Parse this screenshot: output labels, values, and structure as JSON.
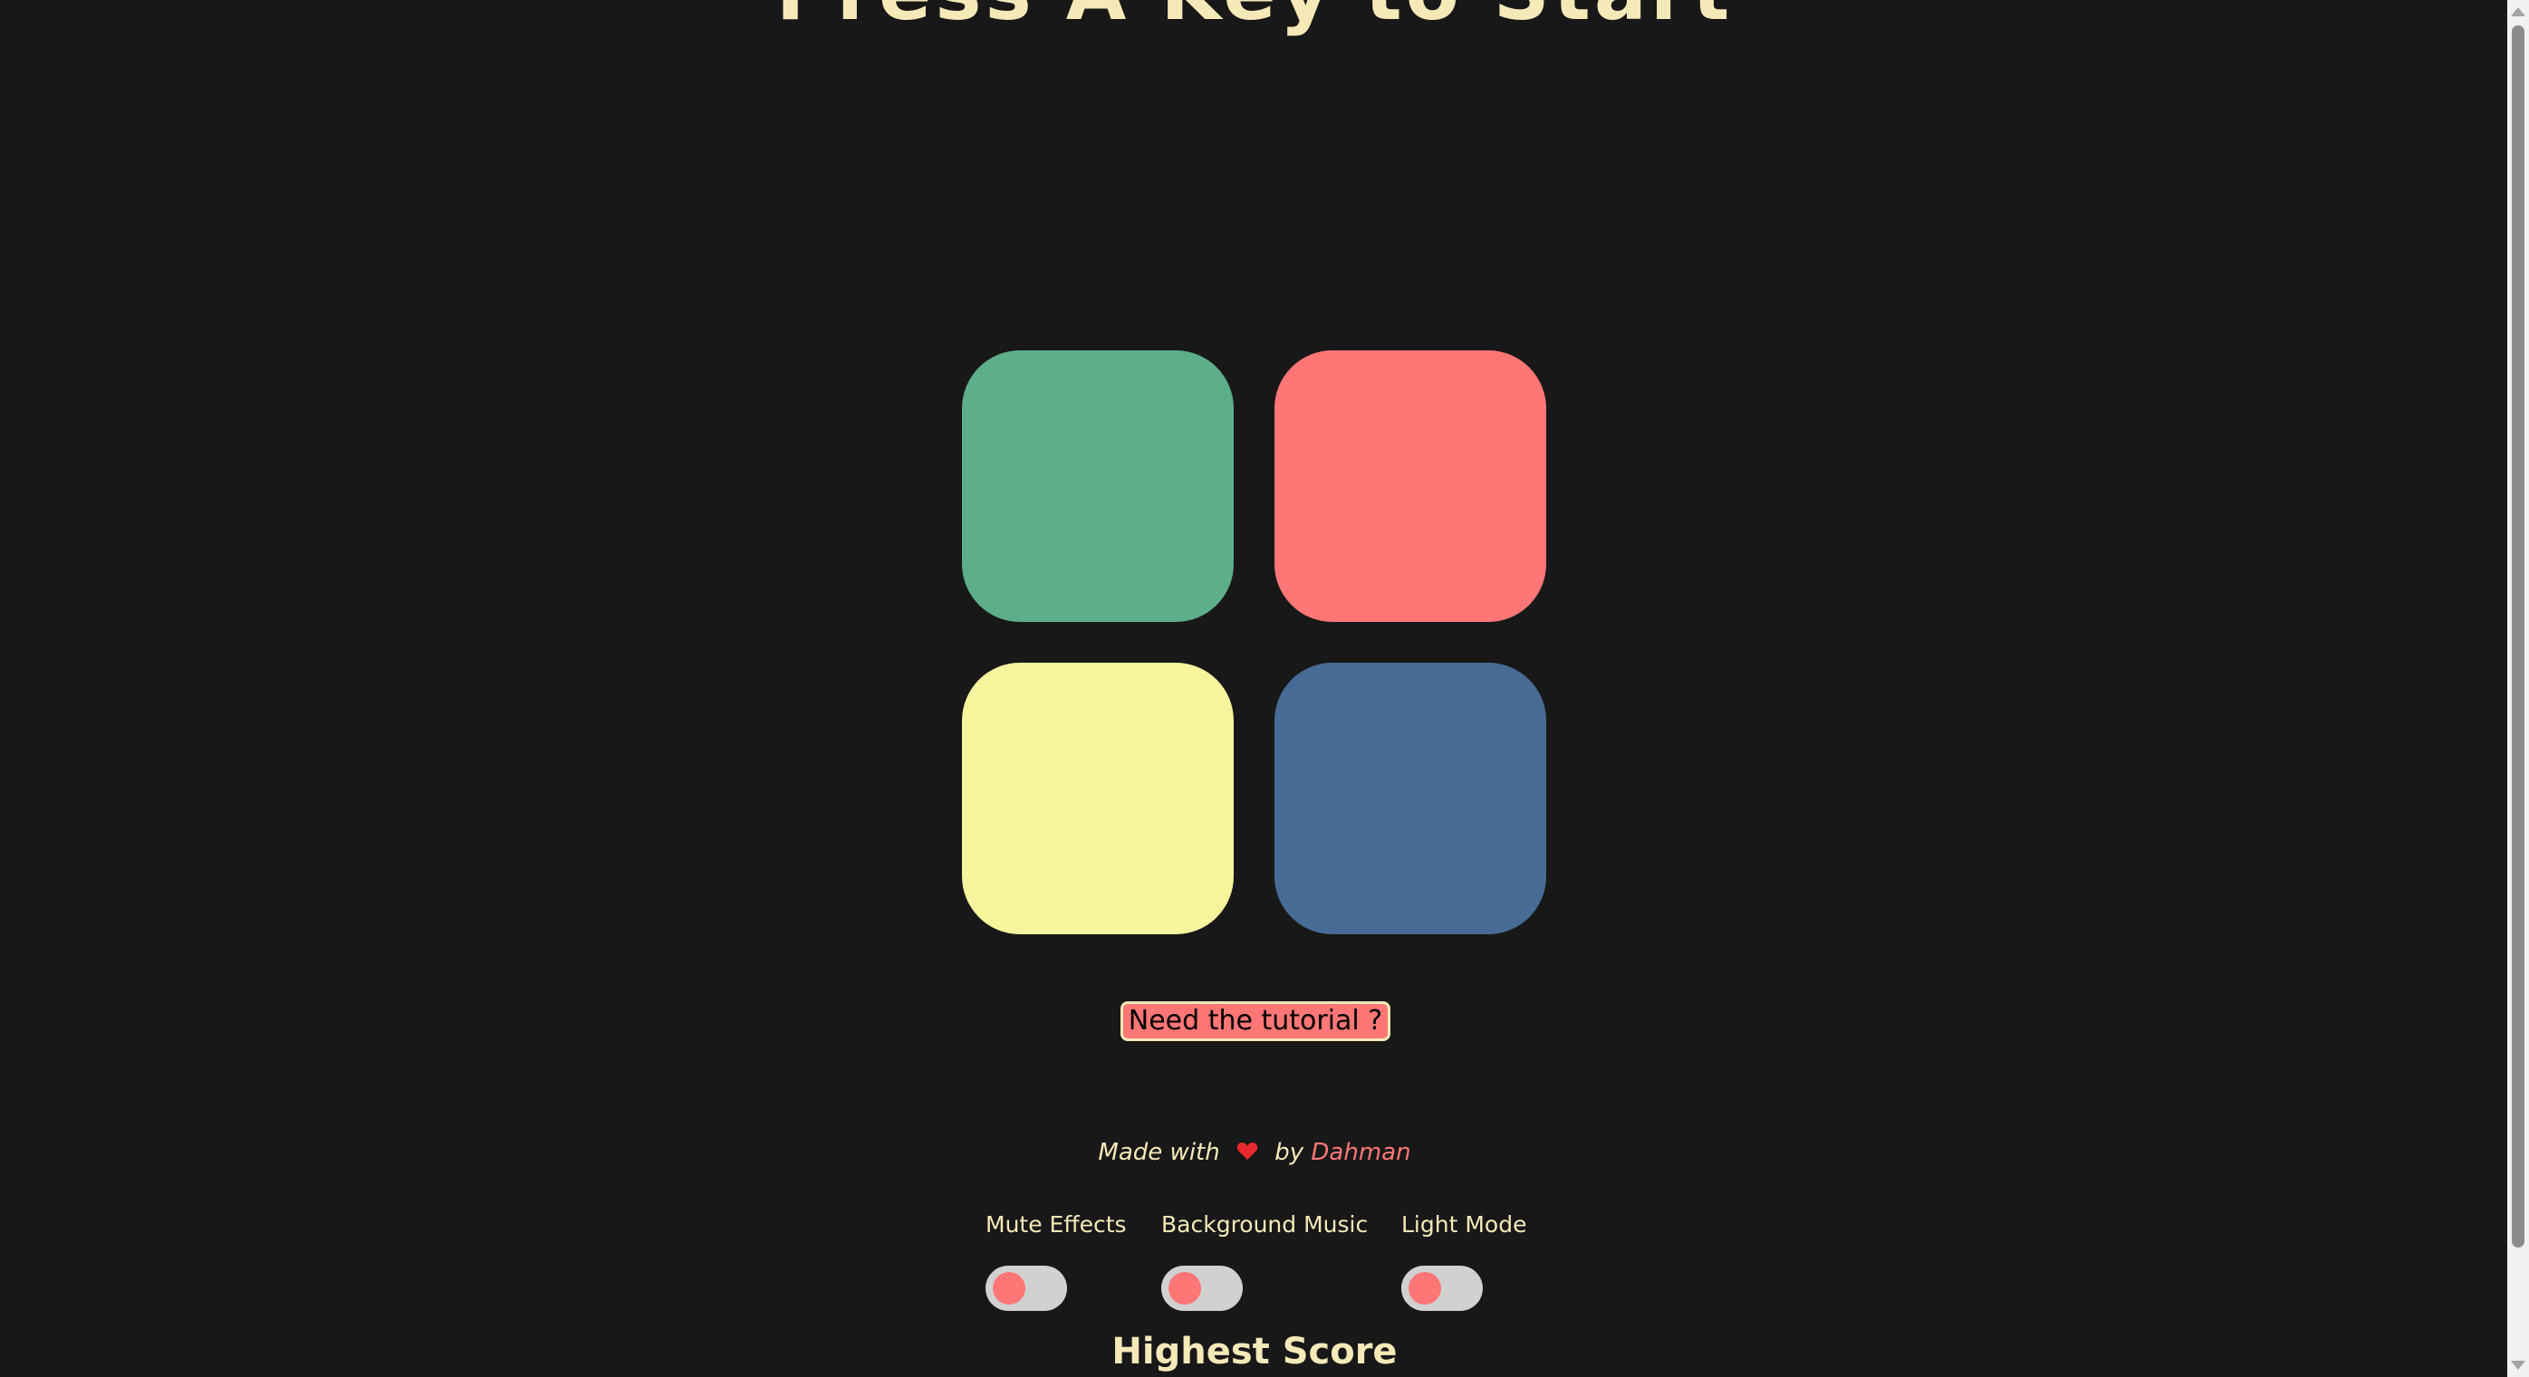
{
  "title": "Press A Key to Start",
  "colors": {
    "background": "#181818",
    "text": "#f5e9b8",
    "accent": "#ff7676",
    "pad_green": "#5dae8b",
    "pad_red": "#ff7676",
    "pad_yellow": "#f6f49d",
    "pad_blue": "#466c95",
    "switch_track": "#d1d1d1",
    "switch_knob": "#ff7676",
    "heart": "#e8282c"
  },
  "pads": [
    {
      "name": "green-pad",
      "color_key": "pad_green"
    },
    {
      "name": "red-pad",
      "color_key": "pad_red"
    },
    {
      "name": "yellow-pad",
      "color_key": "pad_yellow"
    },
    {
      "name": "blue-pad",
      "color_key": "pad_blue"
    }
  ],
  "tutorial_button": {
    "label": "Need the tutorial ?"
  },
  "credits": {
    "prefix": "Made with",
    "icon": "heart-icon",
    "middle": "by",
    "author": "Dahman"
  },
  "toggles": {
    "mute_effects": {
      "label": "Mute Effects",
      "on": false
    },
    "background_music": {
      "label": "Background Music",
      "on": false
    },
    "light_mode": {
      "label": "Light Mode",
      "on": false
    }
  },
  "highest_score": {
    "label": "Highest Score"
  }
}
